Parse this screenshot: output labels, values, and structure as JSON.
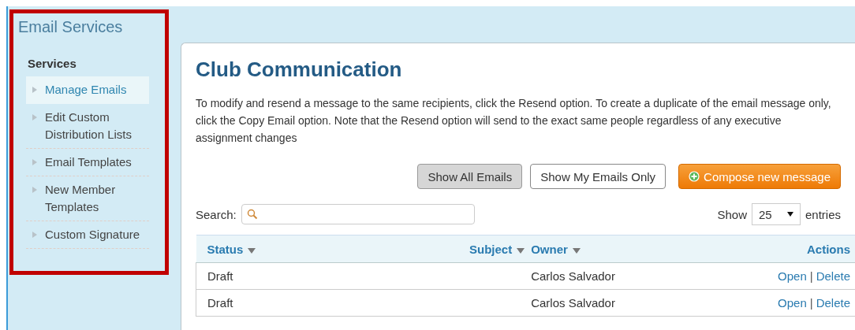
{
  "sidebar": {
    "title": "Email Services",
    "section": "Services",
    "items": [
      {
        "label": "Manage Emails",
        "selected": true
      },
      {
        "label": "Edit Custom Distribution Lists",
        "selected": false
      },
      {
        "label": "Email Templates",
        "selected": false
      },
      {
        "label": "New Member Templates",
        "selected": false
      },
      {
        "label": "Custom Signature",
        "selected": false
      }
    ]
  },
  "main": {
    "title": "Club Communication",
    "description": "To modify and resend a message to the same recipients, click the Resend option. To create a duplicate of the email message only, click the Copy Email option. Note that the Resend option will send to the exact same people regardless of any executive assignment changes",
    "filters": [
      {
        "label": "Show All Emails",
        "selected": true
      },
      {
        "label": "Show My Emails Only",
        "selected": false
      }
    ],
    "compose_button": "Compose new message",
    "search_label": "Search:",
    "show_label": "Show",
    "page_size": "25",
    "entries_label": "entries",
    "table": {
      "columns": [
        {
          "label": "Status",
          "sortable": true
        },
        {
          "label": "Subject",
          "sortable": true
        },
        {
          "label": "Owner",
          "sortable": true
        },
        {
          "label": "Actions",
          "sortable": false
        }
      ],
      "rows": [
        {
          "status": "Draft",
          "owner": "Carlos Salvador",
          "actions": [
            "Open",
            "|",
            "Delete"
          ]
        },
        {
          "status": "Draft",
          "owner": "Carlos Salvador",
          "actions": [
            "Open",
            "|",
            "Delete"
          ]
        }
      ]
    }
  }
}
